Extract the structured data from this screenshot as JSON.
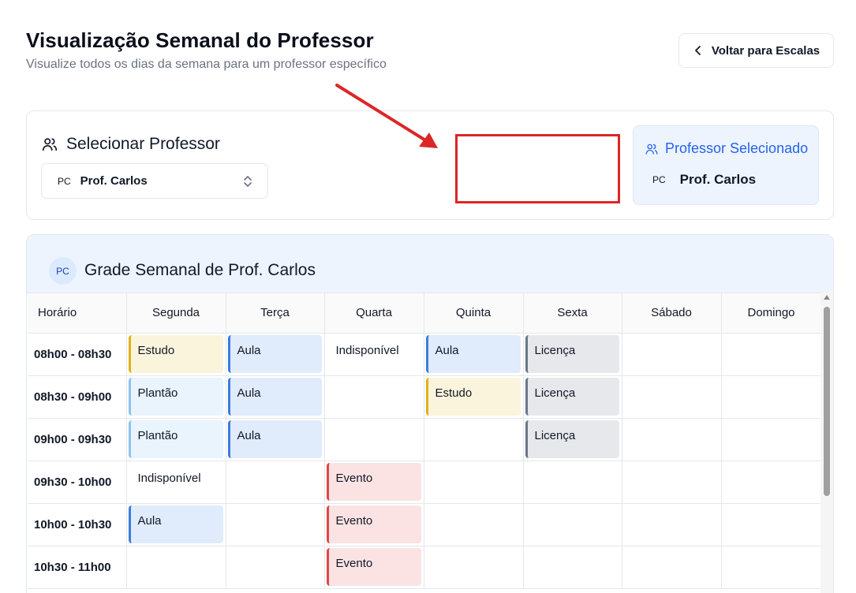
{
  "header": {
    "title": "Visualização Semanal do Professor",
    "subtitle": "Visualize todos os dias da semana para um professor específico",
    "back_label": "Voltar para Escalas"
  },
  "selector": {
    "title": "Selecionar Professor",
    "initials": "PC",
    "value": "Prof. Carlos"
  },
  "selected": {
    "title": "Professor Selecionado",
    "initials": "PC",
    "name": "Prof. Carlos"
  },
  "grid": {
    "avatar": "PC",
    "title": "Grade Semanal de Prof. Carlos",
    "columns": [
      "Horário",
      "Segunda",
      "Terça",
      "Quarta",
      "Quinta",
      "Sexta",
      "Sábado",
      "Domingo"
    ],
    "rows": [
      {
        "time": "08h00 - 08h30",
        "cells": [
          {
            "type": "estudo",
            "label": "Estudo"
          },
          {
            "type": "aula",
            "label": "Aula"
          },
          {
            "type": "plain",
            "label": "Indisponível"
          },
          {
            "type": "aula",
            "label": "Aula"
          },
          {
            "type": "licenca",
            "label": "Licença"
          },
          {
            "type": "empty",
            "label": ""
          },
          {
            "type": "empty",
            "label": ""
          }
        ]
      },
      {
        "time": "08h30 - 09h00",
        "cells": [
          {
            "type": "plantao",
            "label": "Plantão"
          },
          {
            "type": "aula",
            "label": "Aula"
          },
          {
            "type": "empty",
            "label": ""
          },
          {
            "type": "estudo",
            "label": "Estudo"
          },
          {
            "type": "licenca",
            "label": "Licença"
          },
          {
            "type": "empty",
            "label": ""
          },
          {
            "type": "empty",
            "label": ""
          }
        ]
      },
      {
        "time": "09h00 - 09h30",
        "cells": [
          {
            "type": "plantao",
            "label": "Plantão"
          },
          {
            "type": "aula",
            "label": "Aula"
          },
          {
            "type": "empty",
            "label": ""
          },
          {
            "type": "empty",
            "label": ""
          },
          {
            "type": "licenca",
            "label": "Licença"
          },
          {
            "type": "empty",
            "label": ""
          },
          {
            "type": "empty",
            "label": ""
          }
        ]
      },
      {
        "time": "09h30 - 10h00",
        "cells": [
          {
            "type": "plain",
            "label": "Indisponível"
          },
          {
            "type": "empty",
            "label": ""
          },
          {
            "type": "evento",
            "label": "Evento"
          },
          {
            "type": "empty",
            "label": ""
          },
          {
            "type": "empty",
            "label": ""
          },
          {
            "type": "empty",
            "label": ""
          },
          {
            "type": "empty",
            "label": ""
          }
        ]
      },
      {
        "time": "10h00 - 10h30",
        "cells": [
          {
            "type": "aula",
            "label": "Aula"
          },
          {
            "type": "empty",
            "label": ""
          },
          {
            "type": "evento",
            "label": "Evento"
          },
          {
            "type": "empty",
            "label": ""
          },
          {
            "type": "empty",
            "label": ""
          },
          {
            "type": "empty",
            "label": ""
          },
          {
            "type": "empty",
            "label": ""
          }
        ]
      },
      {
        "time": "10h30 - 11h00",
        "cells": [
          {
            "type": "empty",
            "label": ""
          },
          {
            "type": "empty",
            "label": ""
          },
          {
            "type": "evento",
            "label": "Evento"
          },
          {
            "type": "empty",
            "label": ""
          },
          {
            "type": "empty",
            "label": ""
          },
          {
            "type": "empty",
            "label": ""
          },
          {
            "type": "empty",
            "label": ""
          }
        ]
      }
    ]
  },
  "colors": {
    "accent": "#2563eb",
    "annotation": "#dc2626",
    "estudo": "#e0b21a",
    "aula": "#3b7ddd",
    "plantao": "#8cc4ee",
    "licenca": "#6b7686",
    "evento": "#e04545"
  }
}
